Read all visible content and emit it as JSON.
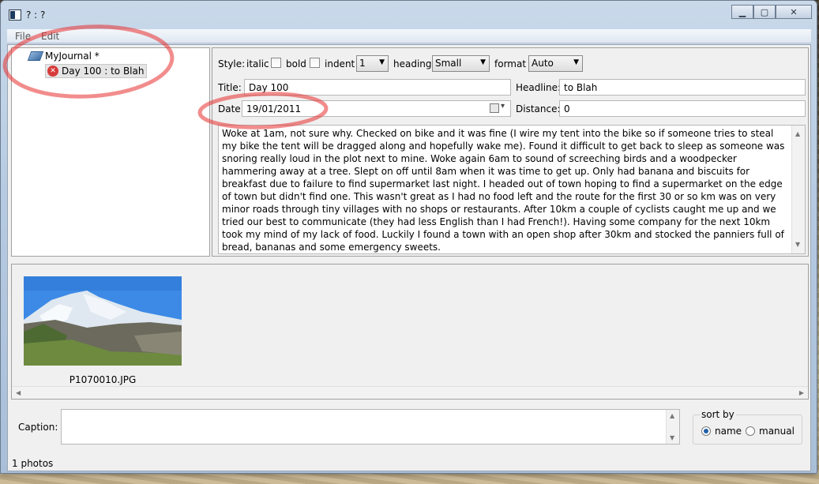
{
  "window": {
    "title": "? : ?"
  },
  "menu": {
    "file": "File",
    "edit": "Edit"
  },
  "tree": {
    "root_label": "MyJournal *",
    "entry_label": "Day 100 : to Blah"
  },
  "style_bar": {
    "style_label": "Style:",
    "italic_label": "italic",
    "bold_label": "bold",
    "indent_label": "indent",
    "indent_value": "1",
    "heading_label": "heading",
    "heading_value": "Small",
    "format_label": "format",
    "format_value": "Auto"
  },
  "fields": {
    "title_label": "Title:",
    "title_value": "Day 100",
    "headline_label": "Headline:",
    "headline_value": "to Blah",
    "date_label": "Date:",
    "date_value": "19/01/2011",
    "distance_label": "Distance:",
    "distance_value": "0"
  },
  "body_text": "Woke at 1am, not sure why. Checked on bike and it was fine (I wire my tent into the bike so if someone tries to steal my bike the tent will be dragged along and hopefully wake me). Found it difficult to get back to sleep as someone was snoring really loud in the plot next to mine. Woke again 6am to sound of screeching birds and a woodpecker hammering away at a tree. Slept on off until 8am when it was time to get up. Only had banana and biscuits for breakfast due to failure to find supermarket last night. I headed out of town hoping to find a supermarket on the edge of town but didn't find one. This wasn't great as I had no food left and the route for the first 30 or so km was on very minor roads through tiny villages with no shops or restaurants. After 10km a couple of cyclists caught me up and we tried our best to communicate (they had less English than I had French!). Having some company for the next 10km took my mind of my lack of food. Luckily I found a town with an open shop after 30km and stocked the panniers full of bread, bananas and some emergency sweets.",
  "photos": [
    {
      "filename": "P1070010.JPG"
    }
  ],
  "caption": {
    "label": "Caption:",
    "value": ""
  },
  "sort": {
    "title": "sort by",
    "name_label": "name",
    "manual_label": "manual",
    "selected": "name"
  },
  "status": "1 photos",
  "colors": {
    "annotation": "#e8302f",
    "selection_blue": "#1f5fa8"
  }
}
